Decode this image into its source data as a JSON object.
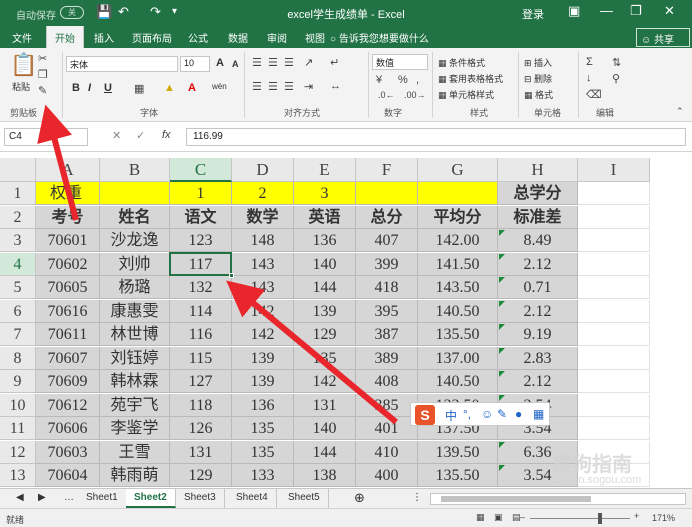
{
  "titlebar": {
    "autosave_label": "自动保存",
    "autosave_state": "关",
    "window_title": "excel学生成绩单 - Excel",
    "login_label": "登录",
    "bg_color": "#217346"
  },
  "ribbon_tabs": [
    "文件",
    "开始",
    "插入",
    "页面布局",
    "公式",
    "数据",
    "审阅",
    "视图"
  ],
  "active_tab": "开始",
  "tell_me": "告诉我您想要做什么",
  "share_label": "共享",
  "ribbon": {
    "clipboard": {
      "paste": "粘贴",
      "group": "剪贴板"
    },
    "font": {
      "name": "宋体",
      "size": "10",
      "bold": "B",
      "italic": "I",
      "underline": "U",
      "grow": "A",
      "shrink": "A",
      "wen": "wén",
      "group": "字体"
    },
    "alignment": {
      "group": "对齐方式"
    },
    "number": {
      "format": "数值",
      "group": "数字"
    },
    "styles": {
      "cond": "条件格式",
      "table": "套用表格格式",
      "cell": "单元格样式",
      "group": "样式"
    },
    "cells": {
      "insert": "插入",
      "delete": "删除",
      "format": "格式",
      "group": "单元格"
    },
    "editing": {
      "group": "编辑"
    }
  },
  "formula_bar": {
    "name_box": "C4",
    "value": "116.99",
    "fx": "fx"
  },
  "columns": [
    "A",
    "B",
    "C",
    "D",
    "E",
    "F",
    "G",
    "H",
    "I"
  ],
  "selected_column": "C",
  "selected_row": "4",
  "rows": [
    {
      "num": "1",
      "cells": [
        "权重",
        "",
        "1",
        "2",
        "3",
        "",
        "",
        "总学分",
        ""
      ]
    },
    {
      "num": "2",
      "cells": [
        "考号",
        "姓名",
        "语文",
        "数学",
        "英语",
        "总分",
        "平均分",
        "标准差",
        ""
      ]
    },
    {
      "num": "3",
      "cells": [
        "70601",
        "沙龙逸",
        "123",
        "148",
        "136",
        "407",
        "142.00",
        "8.49",
        ""
      ]
    },
    {
      "num": "4",
      "cells": [
        "70602",
        "刘帅",
        "117",
        "143",
        "140",
        "399",
        "141.50",
        "2.12",
        ""
      ]
    },
    {
      "num": "5",
      "cells": [
        "70605",
        "杨璐",
        "132",
        "143",
        "144",
        "418",
        "143.50",
        "0.71",
        ""
      ]
    },
    {
      "num": "6",
      "cells": [
        "70616",
        "康惠雯",
        "114",
        "142",
        "139",
        "395",
        "140.50",
        "2.12",
        ""
      ]
    },
    {
      "num": "7",
      "cells": [
        "70611",
        "林世博",
        "116",
        "142",
        "129",
        "387",
        "135.50",
        "9.19",
        ""
      ]
    },
    {
      "num": "8",
      "cells": [
        "70607",
        "刘钰婷",
        "115",
        "139",
        "135",
        "389",
        "137.00",
        "2.83",
        ""
      ]
    },
    {
      "num": "9",
      "cells": [
        "70609",
        "韩林霖",
        "127",
        "139",
        "142",
        "408",
        "140.50",
        "2.12",
        ""
      ]
    },
    {
      "num": "10",
      "cells": [
        "70612",
        "苑宇飞",
        "118",
        "136",
        "131",
        "385",
        "133.50",
        "3.54",
        ""
      ]
    },
    {
      "num": "11",
      "cells": [
        "70606",
        "李鉴学",
        "126",
        "135",
        "140",
        "401",
        "137.50",
        "3.54",
        ""
      ]
    },
    {
      "num": "12",
      "cells": [
        "70603",
        "王雪",
        "131",
        "135",
        "144",
        "410",
        "139.50",
        "6.36",
        ""
      ]
    },
    {
      "num": "13",
      "cells": [
        "70604",
        "韩雨萌",
        "129",
        "133",
        "138",
        "400",
        "135.50",
        "3.54",
        ""
      ]
    }
  ],
  "sheet_tabs": [
    "Sheet1",
    "Sheet2",
    "Sheet3",
    "Sheet4",
    "Sheet5"
  ],
  "active_sheet": "Sheet2",
  "status": {
    "ready": "就绪",
    "zoom": "171%"
  },
  "ime": {
    "logo": "S",
    "mode": "中"
  },
  "watermark": {
    "text": "搜狗指南",
    "url": "zhinan.sogou.com"
  },
  "colors": {
    "accent": "#217346",
    "header_fill": "#d6d6d6",
    "weight_fill": "#ffff00",
    "arrow": "#e8262b"
  }
}
